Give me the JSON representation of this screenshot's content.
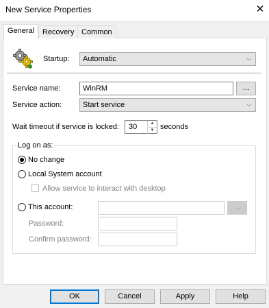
{
  "window": {
    "title": "New Service Properties"
  },
  "tabs": [
    {
      "label": "General"
    },
    {
      "label": "Recovery"
    },
    {
      "label": "Common"
    }
  ],
  "general": {
    "startup_label": "Startup:",
    "startup_value": "Automatic",
    "service_name_label": "Service name:",
    "service_name_value": "WinRM",
    "browse_label": "...",
    "service_action_label": "Service action:",
    "service_action_value": "Start service",
    "wait_timeout_label": "Wait timeout if service is locked:",
    "wait_timeout_value": "30",
    "wait_timeout_unit": "seconds"
  },
  "logon": {
    "group_title": "Log on as:",
    "no_change": "No change",
    "local_system": "Local System account",
    "allow_interact": "Allow service to interact with desktop",
    "this_account": "This account:",
    "account_browse": "...",
    "password_label": "Password:",
    "confirm_label": "Confirm password:",
    "selected": "No change"
  },
  "buttons": {
    "ok": "OK",
    "cancel": "Cancel",
    "apply": "Apply",
    "help": "Help"
  }
}
